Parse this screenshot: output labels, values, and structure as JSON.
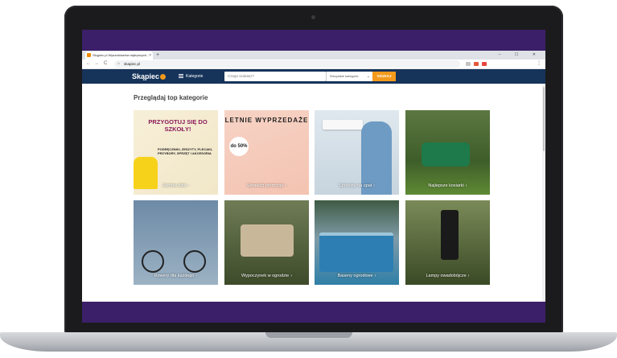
{
  "browser": {
    "tab_title": "Skąpiec.pl Wyszukiwarka najlepszych...",
    "tab_close": "×",
    "new_tab": "+",
    "window_controls": "– ☐ ✕",
    "back": "←",
    "forward": "→",
    "reload": "C",
    "home": "⌂",
    "url": "skapiec.pl",
    "menu": "⋮"
  },
  "site": {
    "logo": "Skąpiec",
    "categories_label": "Kategorie",
    "search_placeholder": "Czego szukasz?",
    "category_select": "Wszystkie kategorie",
    "search_button": "SZUKAJ"
  },
  "main": {
    "heading": "Przeglądaj top kategorie",
    "cards": [
      {
        "label": "Zamów dziś",
        "promo": "PRZYGOTUJ SIĘ DO SZKOŁY!",
        "promo_sub": "PODRĘCZNIKI, ZESZYTY, PLECAKI, PRZYBORY, SPRZĘT I AKCESORIA"
      },
      {
        "label": "Sprawdź promocje",
        "promo": "LETNIE WYPRZEDAŻE",
        "badge": "do 50%"
      },
      {
        "label": "Sposoby na upał"
      },
      {
        "label": "Najlepsze kosiarki"
      },
      {
        "label": "Rowery dla każdego"
      },
      {
        "label": "Wypoczynek w ogrodzie"
      },
      {
        "label": "Baseny ogrodowe"
      },
      {
        "label": "Lampy owadobójcze"
      }
    ],
    "arrow": "›"
  },
  "colors": {
    "site_header": "#16335a",
    "accent_orange": "#f39a1c",
    "screen_frame": "#3b1f68"
  }
}
